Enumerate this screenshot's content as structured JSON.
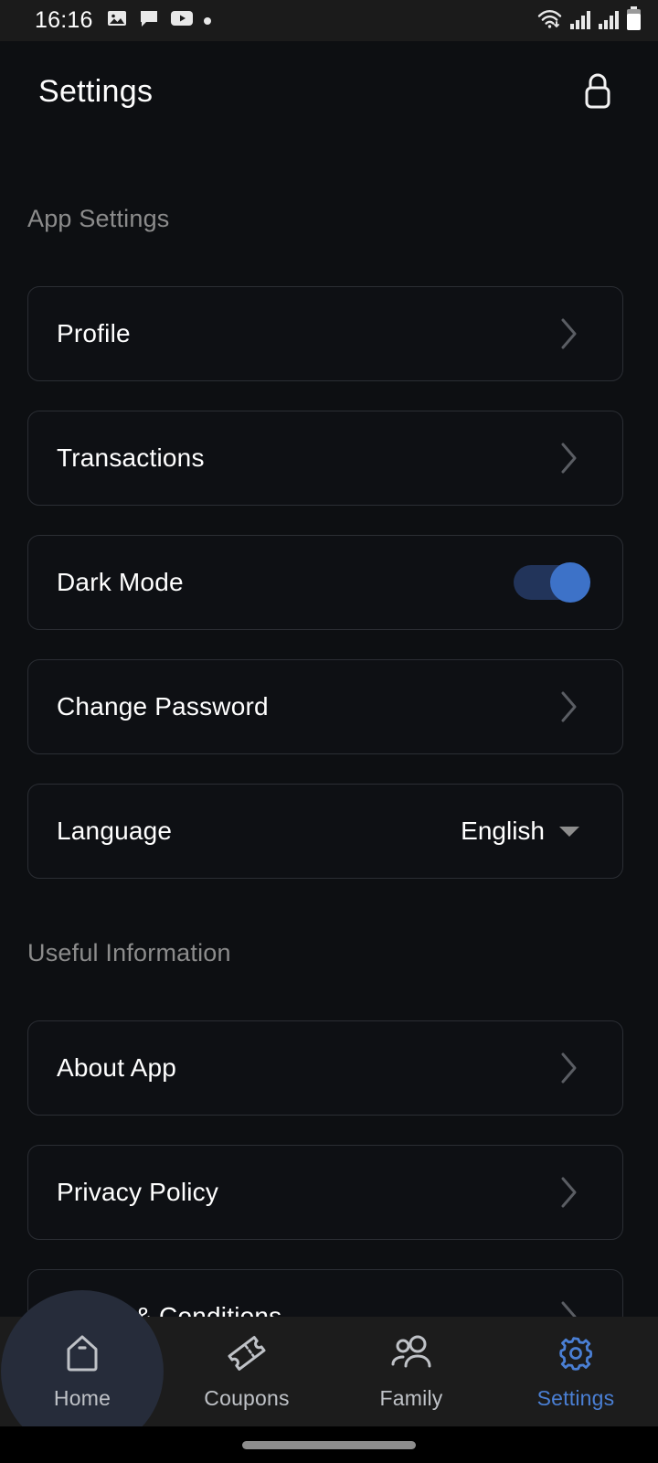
{
  "status_bar": {
    "time": "16:16",
    "left_icons": [
      "gallery-icon",
      "chat-bubble-icon",
      "youtube-icon",
      "dot-indicator"
    ],
    "right_icons": [
      "wifi-icon",
      "signal-icon-sim1",
      "signal-icon-sim2",
      "battery-icon"
    ]
  },
  "header": {
    "title": "Settings",
    "action_icon": "lock-icon"
  },
  "sections": [
    {
      "title": "App Settings",
      "items": [
        {
          "label": "Profile",
          "type": "chevron"
        },
        {
          "label": "Transactions",
          "type": "chevron"
        },
        {
          "label": "Dark Mode",
          "type": "toggle",
          "toggle_on": true
        },
        {
          "label": "Change Password",
          "type": "chevron"
        },
        {
          "label": "Language",
          "type": "dropdown",
          "value": "English"
        }
      ]
    },
    {
      "title": "Useful Information",
      "items": [
        {
          "label": "About App",
          "type": "chevron"
        },
        {
          "label": "Privacy Policy",
          "type": "chevron"
        },
        {
          "label": "Terms & Conditions",
          "type": "chevron"
        }
      ]
    }
  ],
  "bottom_nav": {
    "items": [
      {
        "label": "Home",
        "icon": "home-icon",
        "active": false,
        "pressed": true
      },
      {
        "label": "Coupons",
        "icon": "ticket-icon",
        "active": false,
        "pressed": false
      },
      {
        "label": "Family",
        "icon": "people-icon",
        "active": false,
        "pressed": false
      },
      {
        "label": "Settings",
        "icon": "gear-icon",
        "active": true,
        "pressed": false
      }
    ]
  },
  "colors": {
    "background": "#0d0f12",
    "card_border": "#2b2e34",
    "accent_blue": "#4a7fd4",
    "toggle_track": "#22345a",
    "toggle_knob": "#3d72c8",
    "section_title": "#8c8c8c",
    "nav_background": "#1c1c1c"
  }
}
